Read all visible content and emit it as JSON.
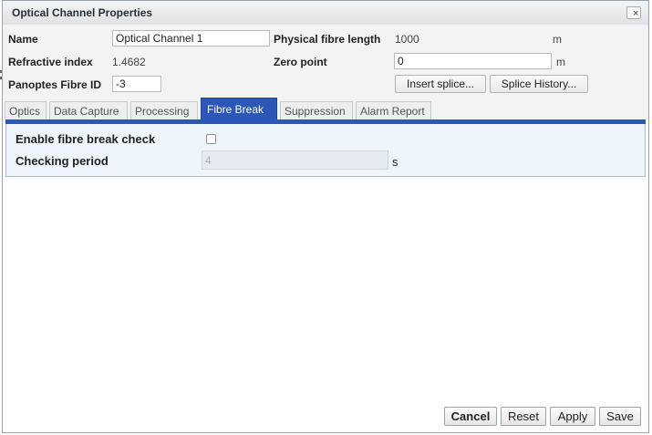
{
  "window": {
    "title": "Optical Channel Properties",
    "close_glyph": "×"
  },
  "properties": {
    "name_label": "Name",
    "name_value": "Optical Channel 1",
    "physical_length_label": "Physical fibre length",
    "physical_length_value": "1000",
    "physical_length_unit": "m",
    "refractive_label": "Refractive index",
    "refractive_value": "1.4682",
    "zero_point_label": "Zero point",
    "zero_point_value": "0",
    "zero_point_unit": "m",
    "panoptes_label": "Panoptes Fibre ID",
    "panoptes_value": "-3",
    "insert_splice_label": "Insert splice...",
    "splice_history_label": "Splice History..."
  },
  "tabs": [
    {
      "label": "Optics"
    },
    {
      "label": "Data Capture"
    },
    {
      "label": "Processing"
    },
    {
      "label": "Fibre Break",
      "active": true
    },
    {
      "label": "Suppression"
    },
    {
      "label": "Alarm Report"
    }
  ],
  "fibre_break": {
    "enable_label": "Enable fibre break check",
    "enable_checked": false,
    "period_label": "Checking period",
    "period_value": "4",
    "period_unit": "s"
  },
  "footer": {
    "cancel_label": "Cancel",
    "reset_label": "Reset",
    "apply_label": "Apply",
    "save_label": "Save"
  },
  "colors": {
    "active_tab": "#2b57b8",
    "panel_background": "#eef5fd",
    "panel_border": "#99bce8"
  }
}
